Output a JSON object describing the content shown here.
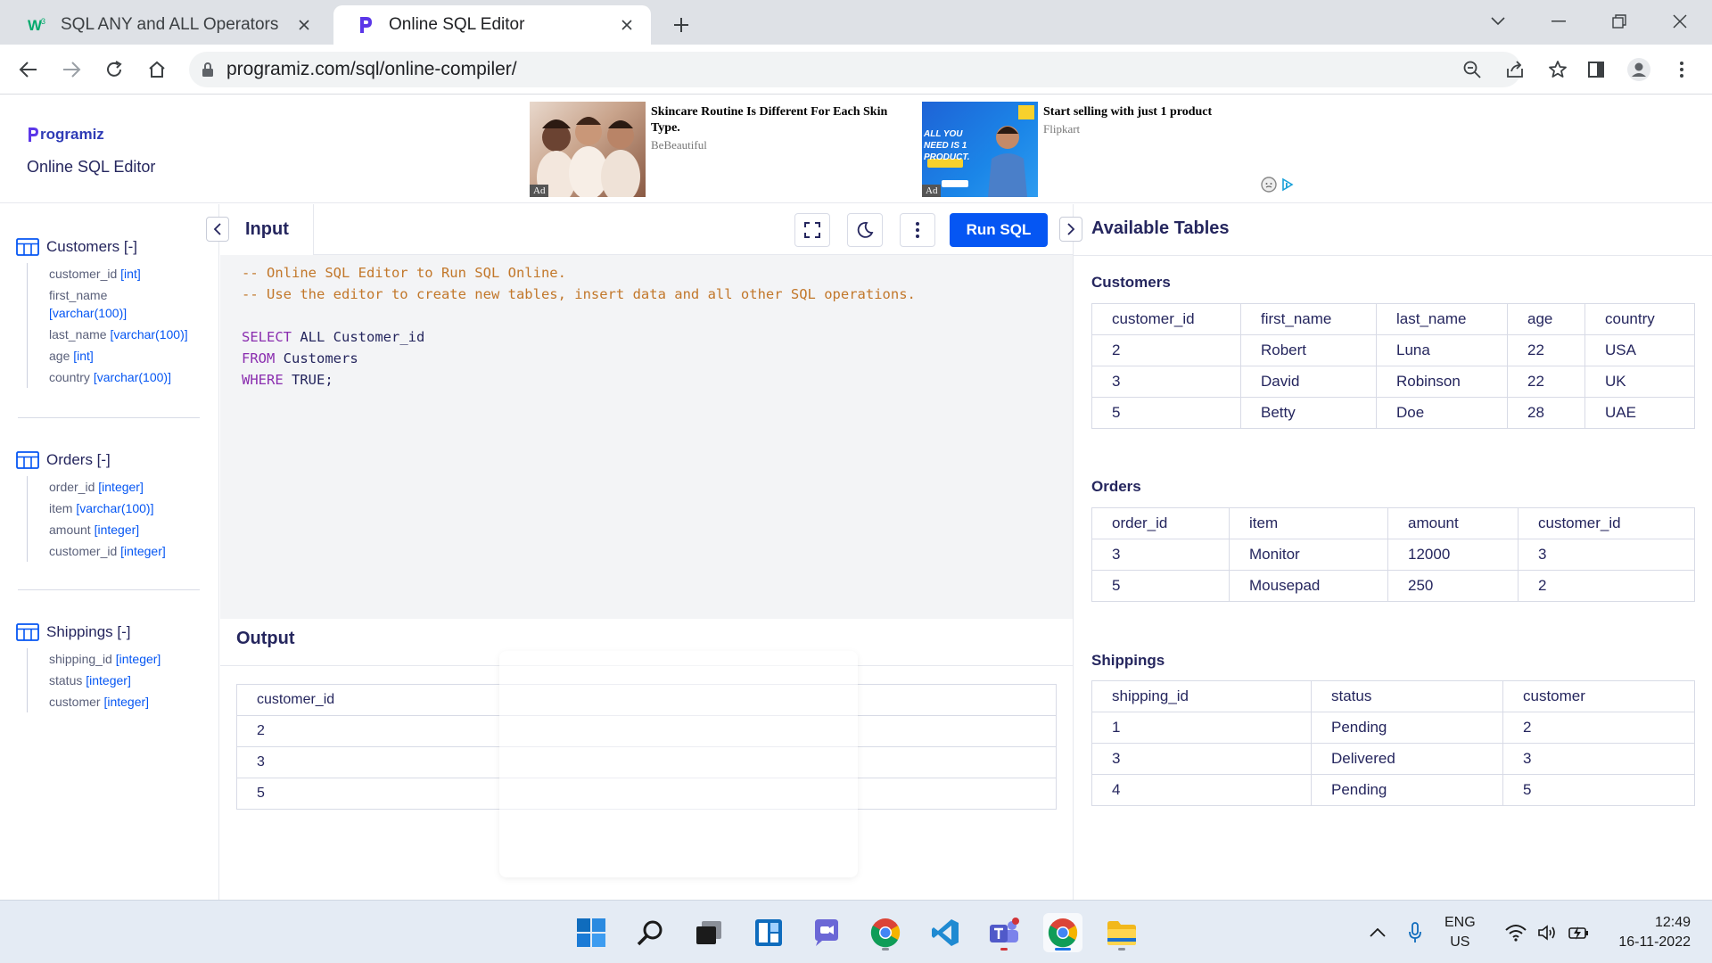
{
  "browser": {
    "tabs": [
      {
        "title": "SQL ANY and ALL Operators",
        "active": false
      },
      {
        "title": "Online SQL Editor",
        "active": true
      }
    ],
    "url": "programiz.com/sql/online-compiler/"
  },
  "header": {
    "logo_text": "rogramiz",
    "subtitle": "Online SQL Editor",
    "ads": [
      {
        "title": "Skincare Routine Is Different For Each Skin Type.",
        "source": "BeBeautiful",
        "tag": "Ad"
      },
      {
        "title": "Start selling with just 1 product",
        "source": "Flipkart",
        "tag": "Ad",
        "thumb_text": "ALL YOU NEED IS 1 PRODUCT."
      }
    ]
  },
  "sidebar": {
    "tables": [
      {
        "name": "Customers [-]",
        "columns": [
          {
            "name": "customer_id",
            "type": "[int]"
          },
          {
            "name": "first_name",
            "type": "[varchar(100)]"
          },
          {
            "name": "last_name",
            "type": "[varchar(100)]"
          },
          {
            "name": "age",
            "type": "[int]"
          },
          {
            "name": "country",
            "type": "[varchar(100)]"
          }
        ]
      },
      {
        "name": "Orders [-]",
        "columns": [
          {
            "name": "order_id",
            "type": "[integer]"
          },
          {
            "name": "item",
            "type": "[varchar(100)]"
          },
          {
            "name": "amount",
            "type": "[integer]"
          },
          {
            "name": "customer_id",
            "type": "[integer]"
          }
        ]
      },
      {
        "name": "Shippings [-]",
        "columns": [
          {
            "name": "shipping_id",
            "type": "[integer]"
          },
          {
            "name": "status",
            "type": "[integer]"
          },
          {
            "name": "customer",
            "type": "[integer]"
          }
        ]
      }
    ]
  },
  "editor": {
    "tab_label": "Input",
    "run_label": "Run SQL",
    "code": {
      "comment1": "-- Online SQL Editor to Run SQL Online.",
      "comment2": "-- Use the editor to create new tables, insert data and all other SQL operations.",
      "l4_kw": "SELECT",
      "l4_rest": " ALL Customer_id",
      "l5_kw": "FROM",
      "l5_rest": " Customers",
      "l6_kw": "WHERE",
      "l6_rest": " TRUE;"
    }
  },
  "output": {
    "title": "Output",
    "columns": [
      "customer_id"
    ],
    "rows": [
      [
        "2"
      ],
      [
        "3"
      ],
      [
        "5"
      ]
    ]
  },
  "available": {
    "title": "Available Tables",
    "tables": [
      {
        "caption": "Customers",
        "columns": [
          "customer_id",
          "first_name",
          "last_name",
          "age",
          "country"
        ],
        "rows": [
          [
            "2",
            "Robert",
            "Luna",
            "22",
            "USA"
          ],
          [
            "3",
            "David",
            "Robinson",
            "22",
            "UK"
          ],
          [
            "5",
            "Betty",
            "Doe",
            "28",
            "UAE"
          ]
        ]
      },
      {
        "caption": "Orders",
        "columns": [
          "order_id",
          "item",
          "amount",
          "customer_id"
        ],
        "rows": [
          [
            "3",
            "Monitor",
            "12000",
            "3"
          ],
          [
            "5",
            "Mousepad",
            "250",
            "2"
          ]
        ]
      },
      {
        "caption": "Shippings",
        "columns": [
          "shipping_id",
          "status",
          "customer"
        ],
        "rows": [
          [
            "1",
            "Pending",
            "2"
          ],
          [
            "3",
            "Delivered",
            "3"
          ],
          [
            "4",
            "Pending",
            "5"
          ]
        ]
      }
    ]
  },
  "taskbar": {
    "apps": [
      "start-icon",
      "search-icon",
      "task-view-icon",
      "widgets-icon",
      "teams-chat-icon",
      "chrome-icon",
      "vscode-icon",
      "teams-icon",
      "chrome-active-icon",
      "file-explorer-icon"
    ],
    "lang_line1": "ENG",
    "lang_line2": "US",
    "time": "12:49",
    "date": "16-11-2022"
  },
  "colors": {
    "brand": "#0556f3",
    "text": "#25265e",
    "comment": "#c2772a",
    "keyword": "#8a2daf"
  }
}
